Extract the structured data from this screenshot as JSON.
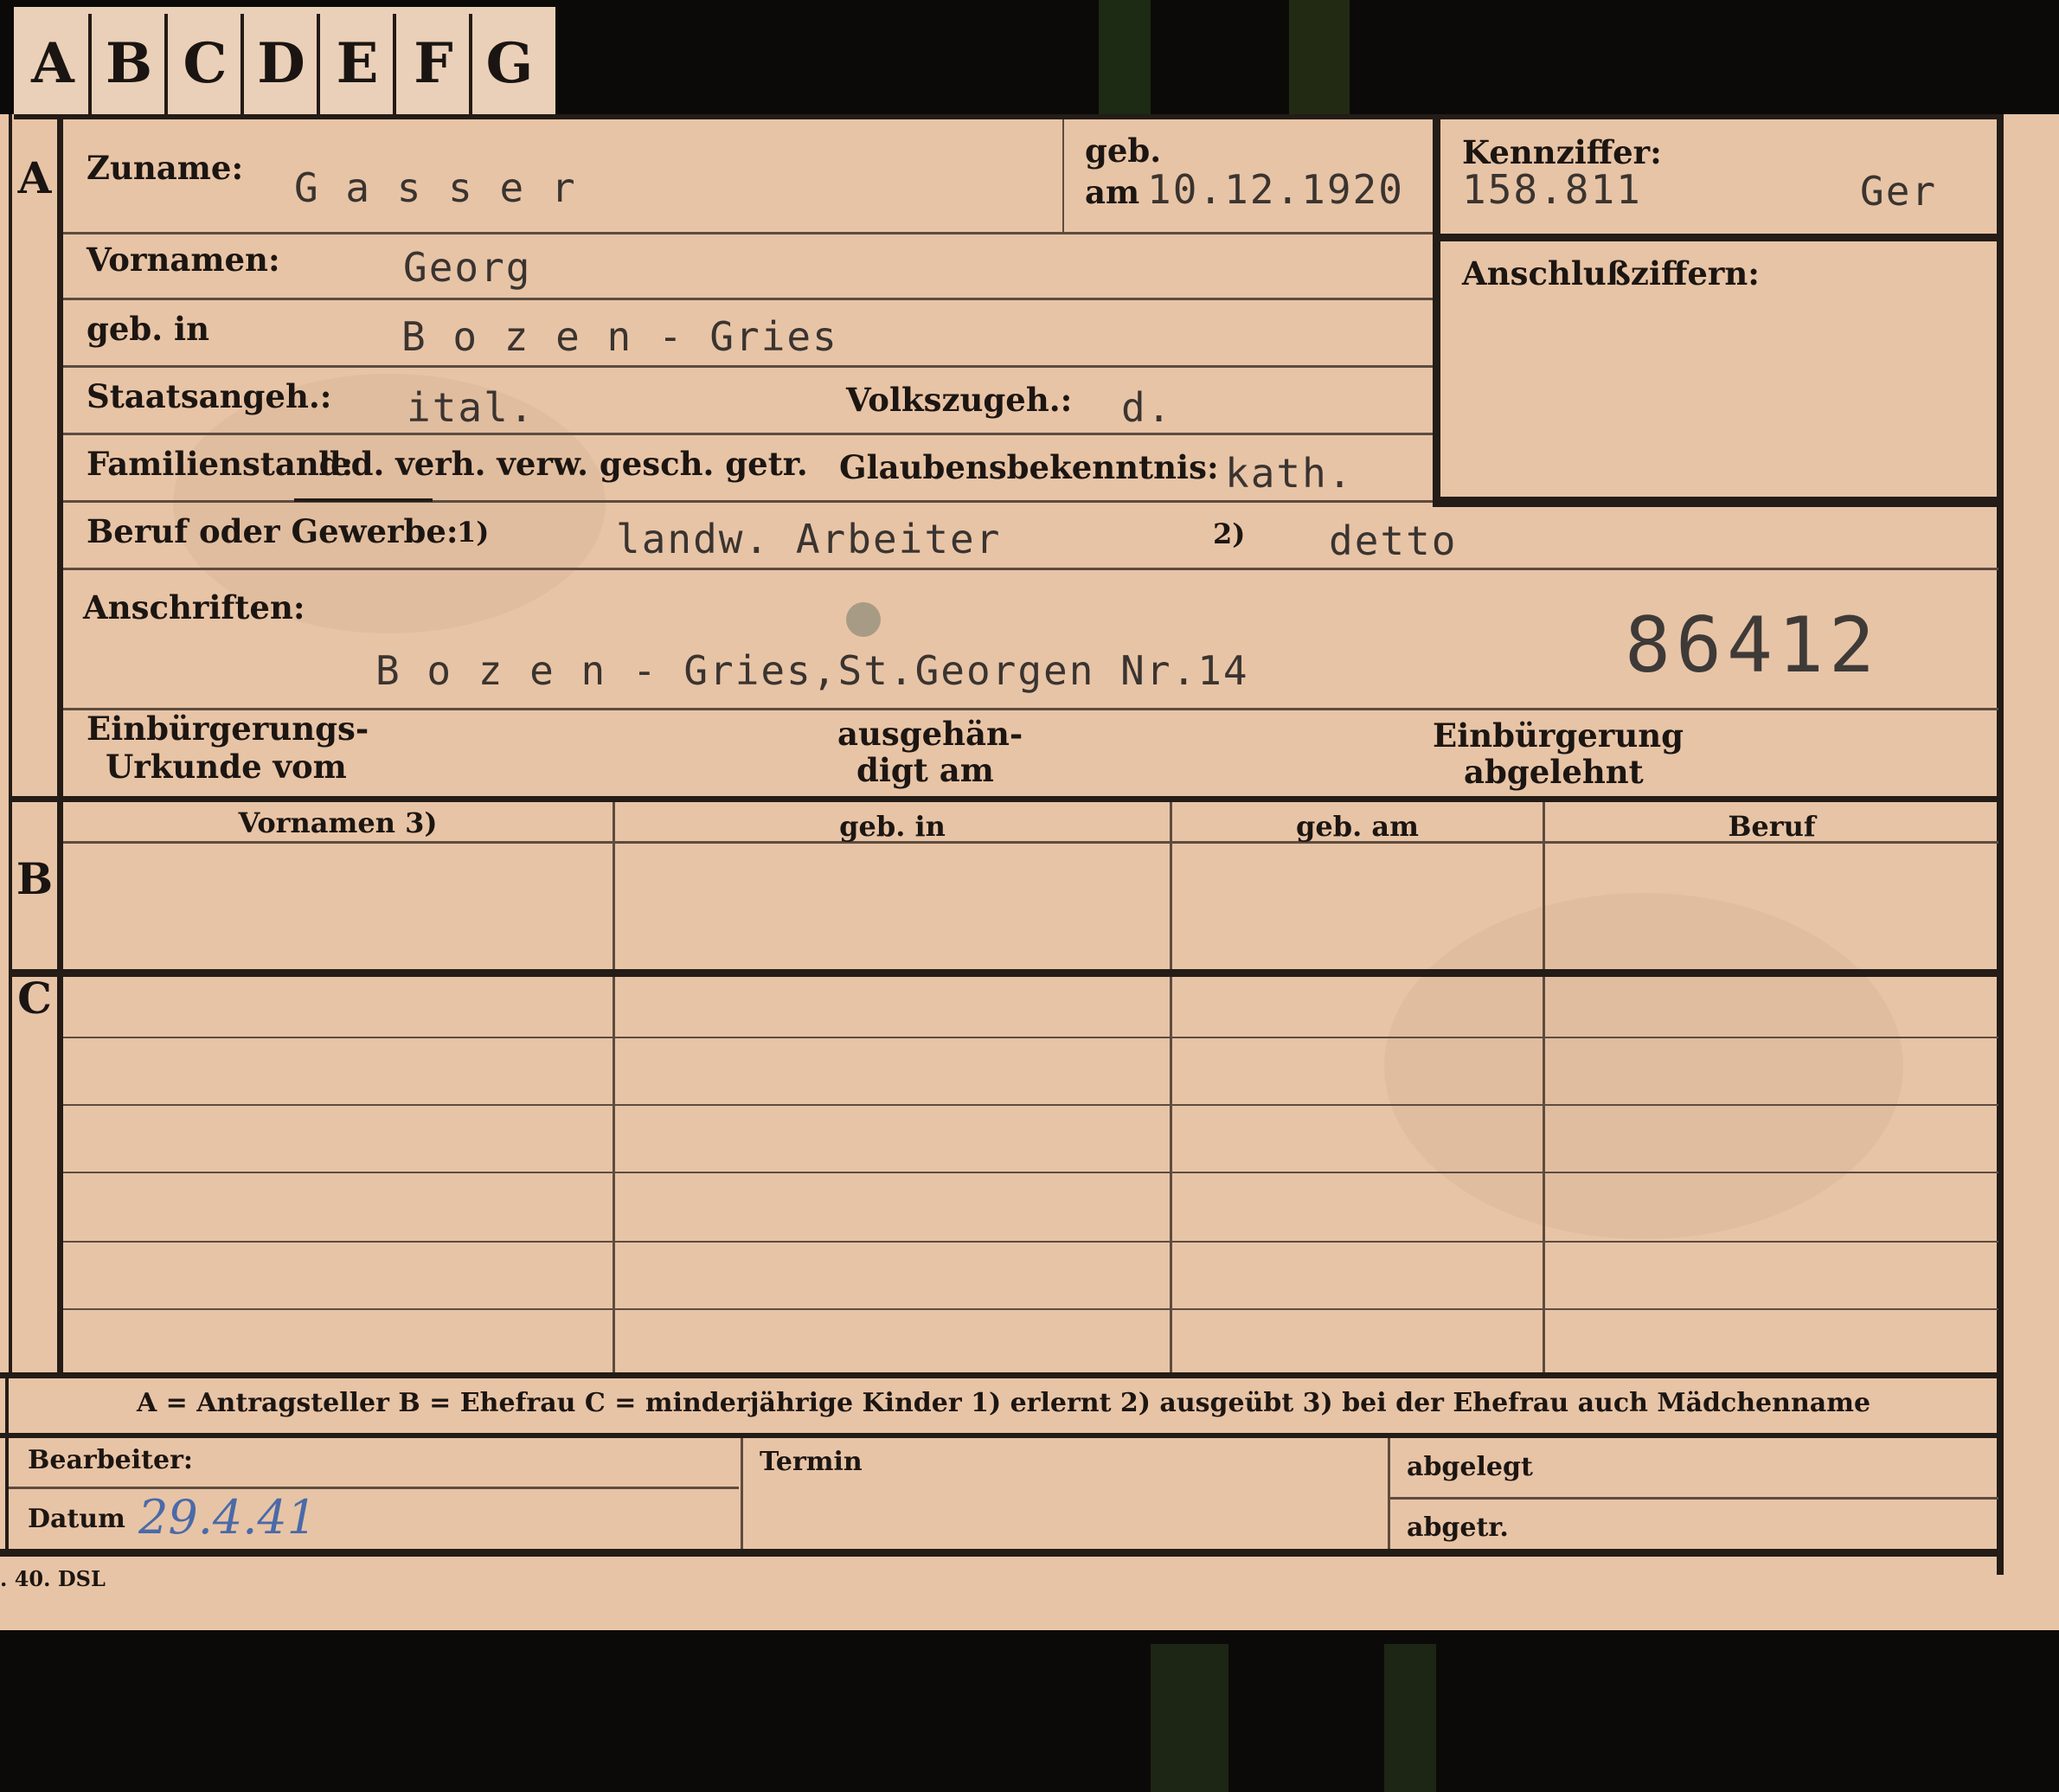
{
  "tabs": [
    "A",
    "B",
    "C",
    "D",
    "E",
    "F",
    "G"
  ],
  "section_letters": {
    "a": "A",
    "b": "B",
    "c": "C"
  },
  "labels": {
    "zuname": "Zuname:",
    "geb": "geb.",
    "am": "am",
    "kennziffer": "Kennziffer:",
    "vornamen": "Vornamen:",
    "anschlussziffern": "Anschlußziffern:",
    "geb_in": "geb. in",
    "staatsangeh": "Staatsangeh.:",
    "volkszugeh": "Volkszugeh.:",
    "familienstand": "Familienstand:",
    "familienstand_options": "led. verh. verw. gesch. getr.",
    "glaubensbekenntnis": "Glaubensbekenntnis:",
    "beruf_oder_gewerbe": "Beruf oder Gewerbe:",
    "note_1": "1)",
    "note_2": "2)",
    "anschriften": "Anschriften:",
    "einbuergerungsurkunde_line1": "Einbürgerungs-",
    "einbuergerungsurkunde_line2": "Urkunde vom",
    "ausgehaendigt_line1": "ausgehän-",
    "ausgehaendigt_line2": "digt am",
    "einbuergerung_abgelehnt_line1": "Einbürgerung",
    "einbuergerung_abgelehnt_line2": "abgelehnt"
  },
  "values": {
    "zuname": "G a s s e r",
    "geb_am": "10.12.1920",
    "kennziffer": "158.811",
    "kennziffer_suffix": "Ger",
    "vornamen": "Georg",
    "geb_in": "B o z e n - Gries",
    "staatsangeh": "ital.",
    "volkszugeh": "d.",
    "glaubensbekenntnis": "kath.",
    "beruf_erlernt": "landw. Arbeiter",
    "beruf_ausgeuebt": "detto",
    "anschrift": "B o z e n - Gries,St.Georgen Nr.14",
    "stamp_number": "86412"
  },
  "family_table": {
    "columns": [
      "Vornamen 3)",
      "geb. in",
      "geb. am",
      "Beruf"
    ]
  },
  "legend": "A = Antragsteller   B = Ehefrau   C = minderjährige Kinder   1) erlernt   2) ausgeübt   3) bei der Ehefrau auch Mädchenname",
  "footer": {
    "bearbeiter": "Bearbeiter:",
    "datum": "Datum",
    "datum_value": "29.4.41",
    "termin": "Termin",
    "abgelegt": "abgelegt",
    "abgetr": "abgetr.",
    "print_mark": ". 40. DSL"
  }
}
